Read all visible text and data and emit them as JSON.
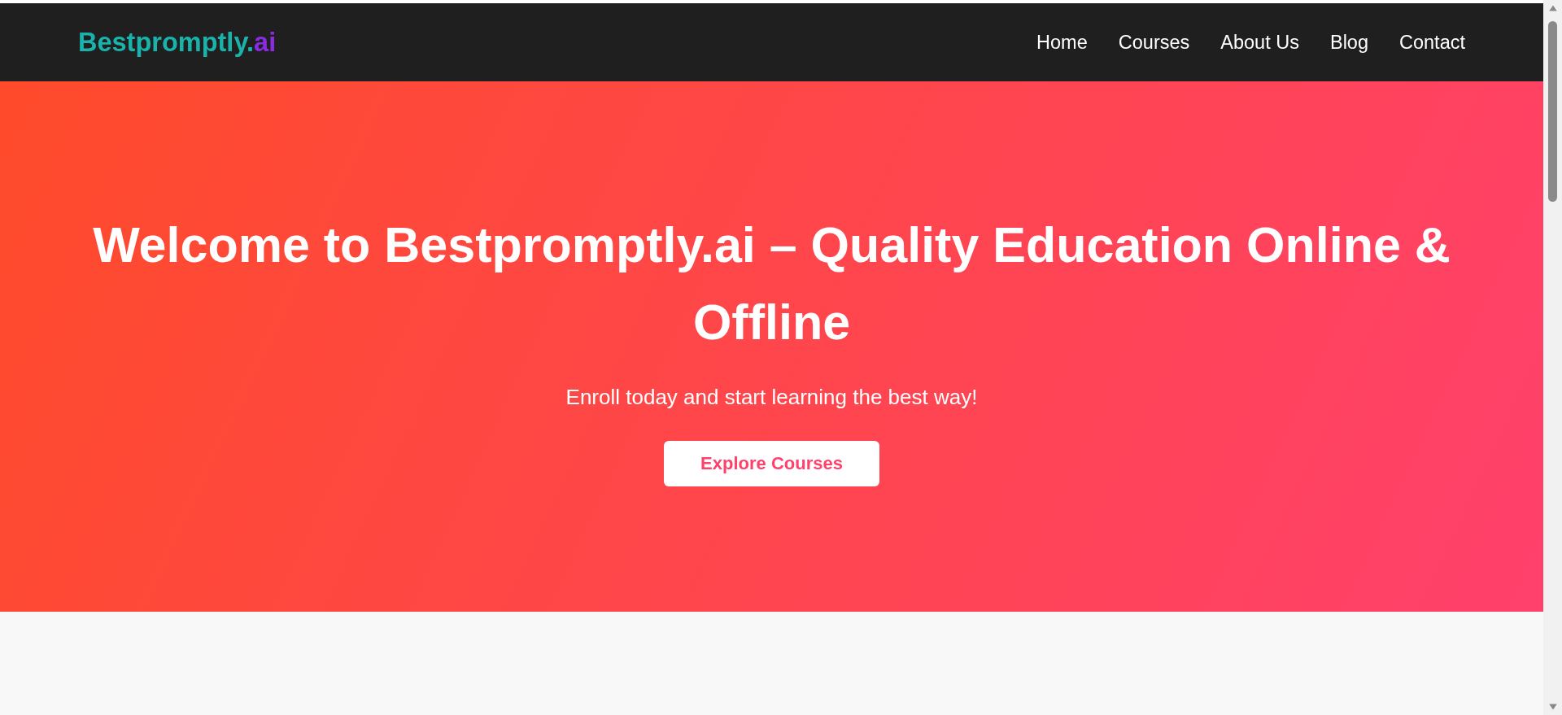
{
  "header": {
    "logo": {
      "name": "Bestpromptly.",
      "suffix": "ai"
    },
    "nav": [
      {
        "label": "Home"
      },
      {
        "label": "Courses"
      },
      {
        "label": "About Us"
      },
      {
        "label": "Blog"
      },
      {
        "label": "Contact"
      }
    ]
  },
  "hero": {
    "title": "Welcome to Bestpromptly.ai – Quality Education Online & Offline",
    "subtitle": "Enroll today and start learning the best way!",
    "button": "Explore Courses"
  }
}
